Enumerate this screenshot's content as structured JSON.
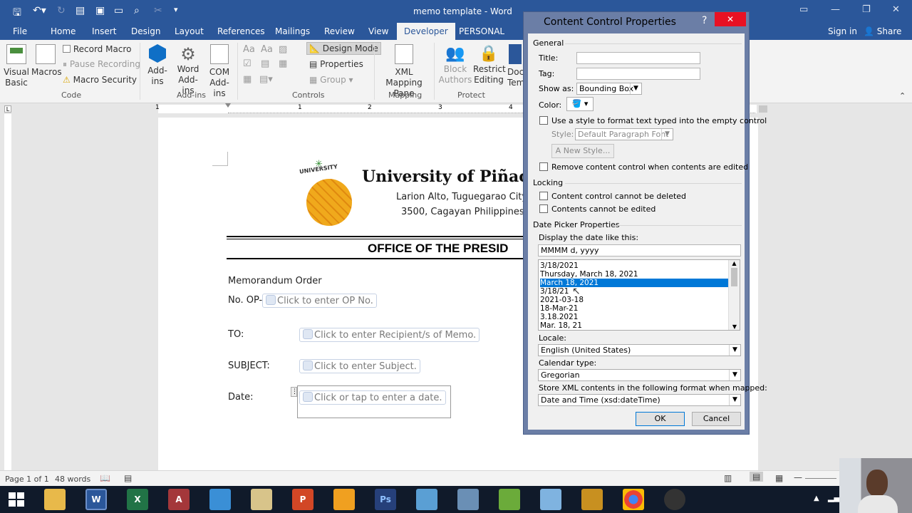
{
  "window": {
    "title": "memo template - Word",
    "sign_in": "Sign in",
    "share": "Share"
  },
  "tabs": [
    "File",
    "Home",
    "Insert",
    "Design",
    "Layout",
    "References",
    "Mailings",
    "Review",
    "View",
    "Developer",
    "PERSONAL"
  ],
  "active_tab": "Developer",
  "ribbon": {
    "code": {
      "visual_basic": "Visual Basic",
      "macros": "Macros",
      "record_macro": "Record Macro",
      "pause_recording": "Pause Recording",
      "macro_security": "Macro Security",
      "group": "Code"
    },
    "addins": {
      "addins": "Add-ins",
      "word_addins": "Word Add-ins",
      "com_addins": "COM Add-ins",
      "group": "Add-ins"
    },
    "controls": {
      "design_mode": "Design Mode",
      "properties": "Properties",
      "group_btn": "Group",
      "group": "Controls"
    },
    "mapping": {
      "xml_mapping": "XML Mapping Pane",
      "group": "Mapping"
    },
    "protect": {
      "block_authors": "Block Authors",
      "restrict_editing": "Restrict Editing",
      "group": "Protect"
    },
    "templates": {
      "doc": "Doc",
      "tem": "Tem"
    }
  },
  "ruler": {
    "ticks": [
      "1",
      "1",
      "2",
      "3",
      "4"
    ]
  },
  "document": {
    "university": "University of Piñachul",
    "logo_text": "UNIVERSITY PINACULADA",
    "address1": "Larion Alto, Tuguegarao City",
    "address2": "3500, Cagayan Philippines",
    "office": "OFFICE OF THE PRESID",
    "memo_order": "Memorandum Order",
    "no_label": "No. OP-",
    "no_ctrl": "Click to enter OP No.",
    "to_label": "TO:",
    "to_ctrl": "Click to enter Recipient/s of Memo.",
    "subject_label": "SUBJECT:",
    "subject_ctrl": "Click to enter Subject.",
    "date_label": "Date:",
    "date_ctrl": "Click or tap to enter a date."
  },
  "status": {
    "page": "Page 1 of 1",
    "words": "48 words"
  },
  "dialog": {
    "title": "Content Control Properties",
    "help": "?",
    "close": "✕",
    "general": "General",
    "title_label": "Title:",
    "title_value": "",
    "tag_label": "Tag:",
    "tag_value": "",
    "show_as_label": "Show as:",
    "show_as_value": "Bounding Box",
    "color_label": "Color:",
    "use_style": "Use a style to format text typed into the empty control",
    "style_label": "Style:",
    "style_value": "Default Paragraph Font",
    "new_style": "New Style...",
    "remove_control": "Remove content control when contents are edited",
    "locking": "Locking",
    "cannot_delete": "Content control cannot be deleted",
    "cannot_edit": "Contents cannot be edited",
    "date_picker": "Date Picker Properties",
    "display_like": "Display the date like this:",
    "format_value": "MMMM d, yyyy",
    "formats": [
      "3/18/2021",
      "Thursday, March 18, 2021",
      "March 18, 2021",
      "3/18/21",
      "2021-03-18",
      "18-Mar-21",
      "3.18.2021",
      "Mar. 18, 21"
    ],
    "selected_format": 2,
    "locale_label": "Locale:",
    "locale_value": "English (United States)",
    "calendar_label": "Calendar type:",
    "calendar_value": "Gregorian",
    "store_label": "Store XML contents in the following format when mapped:",
    "store_value": "Date and Time (xsd:dateTime)",
    "ok": "OK",
    "cancel": "Cancel"
  },
  "colors": {
    "word_blue": "#2b579a",
    "selection": "#0078d7",
    "dialog_frame": "#6b7ea6"
  }
}
